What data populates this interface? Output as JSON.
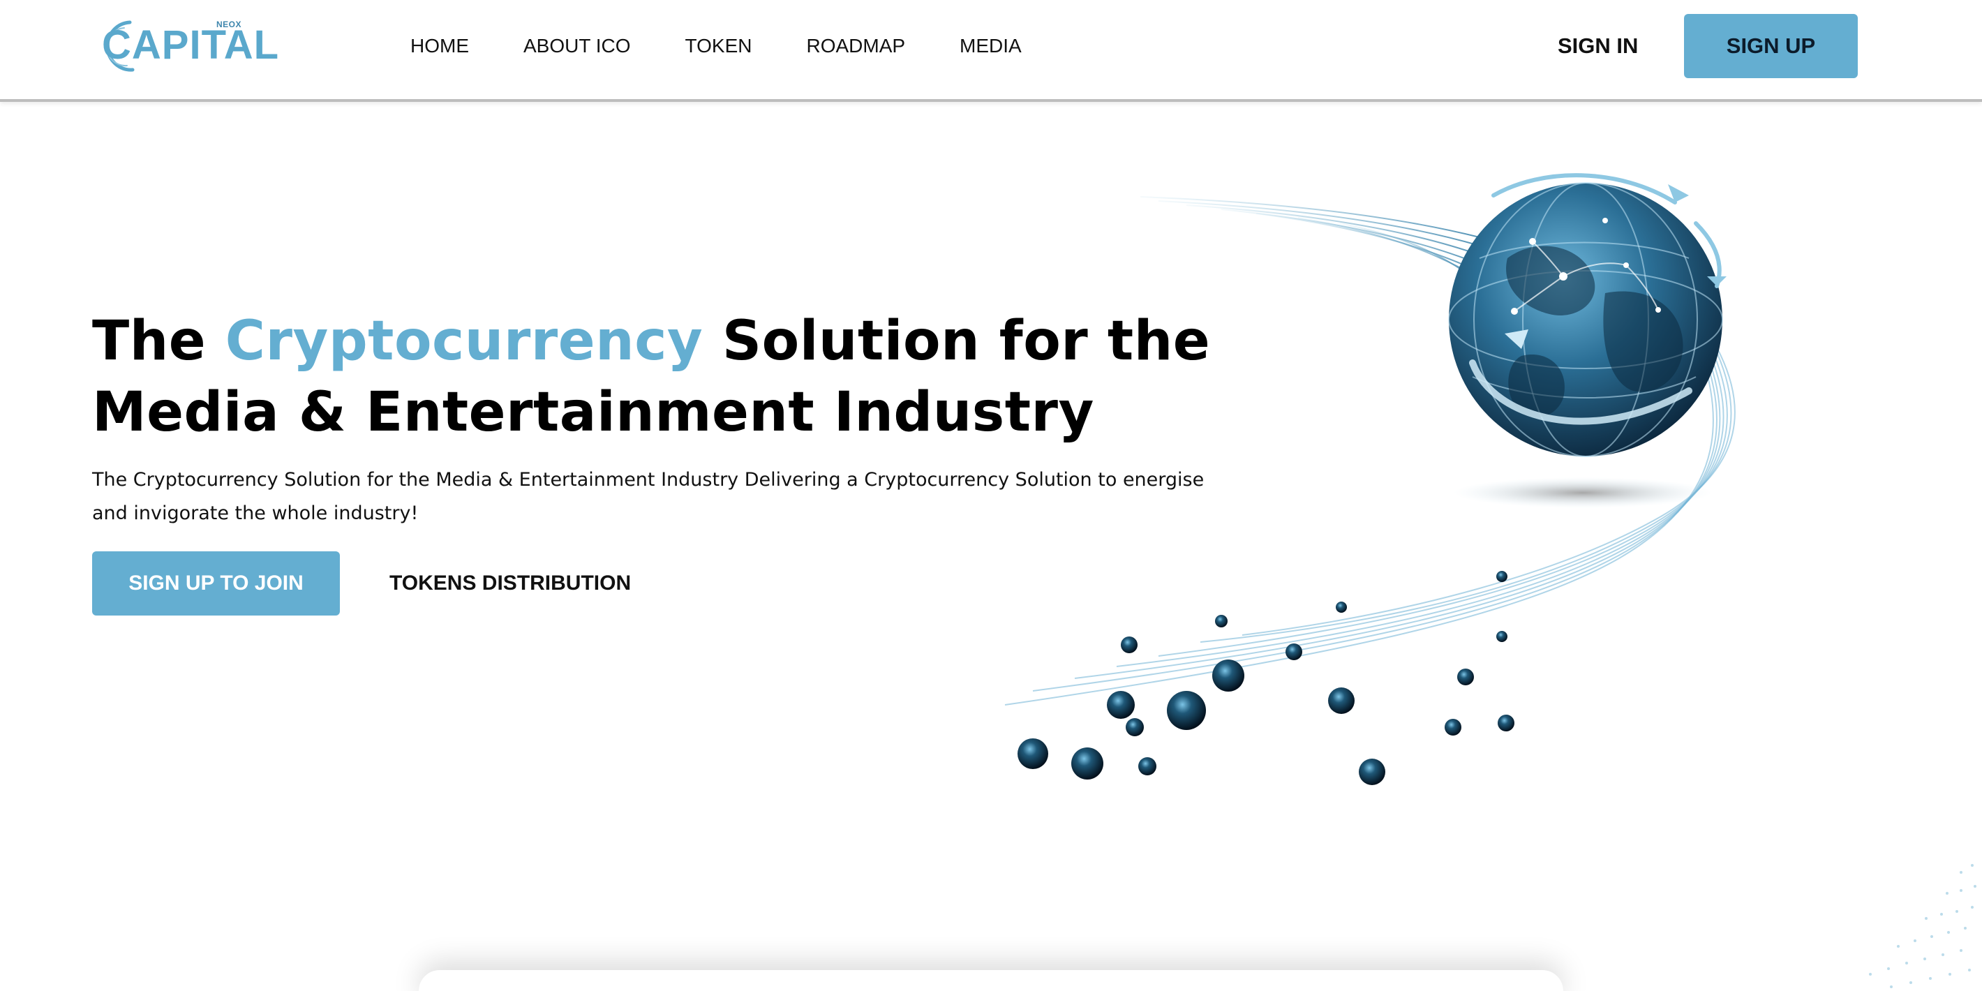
{
  "header": {
    "logo": {
      "wordmark": "CAPITAL",
      "superscript": "NEOX"
    },
    "nav": [
      {
        "label": "HOME"
      },
      {
        "label": "ABOUT ICO"
      },
      {
        "label": "TOKEN"
      },
      {
        "label": "ROADMAP"
      },
      {
        "label": "MEDIA"
      }
    ],
    "sign_in_label": "SIGN IN",
    "sign_up_label": "SIGN UP"
  },
  "hero": {
    "title_before": "The ",
    "title_accent": "Cryptocurrency",
    "title_line1_after": " Solution for the",
    "title_line2": "Media & Entertainment Industry",
    "description": "The Cryptocurrency Solution for the Media & Entertainment Industry Delivering a Cryptocurrency Solution to energise and invigorate the whole industry!",
    "primary_button_label": "SIGN UP TO JOIN",
    "secondary_link_label": "TOKENS DISTRIBUTION"
  },
  "illustration": {
    "icon": "globe-network-icon",
    "description_tokens": "orbiting-coins"
  },
  "colors": {
    "accent": "#64aed1",
    "text": "#000000",
    "globe_dark": "#0f3550",
    "globe_light": "#5aa8cc"
  }
}
